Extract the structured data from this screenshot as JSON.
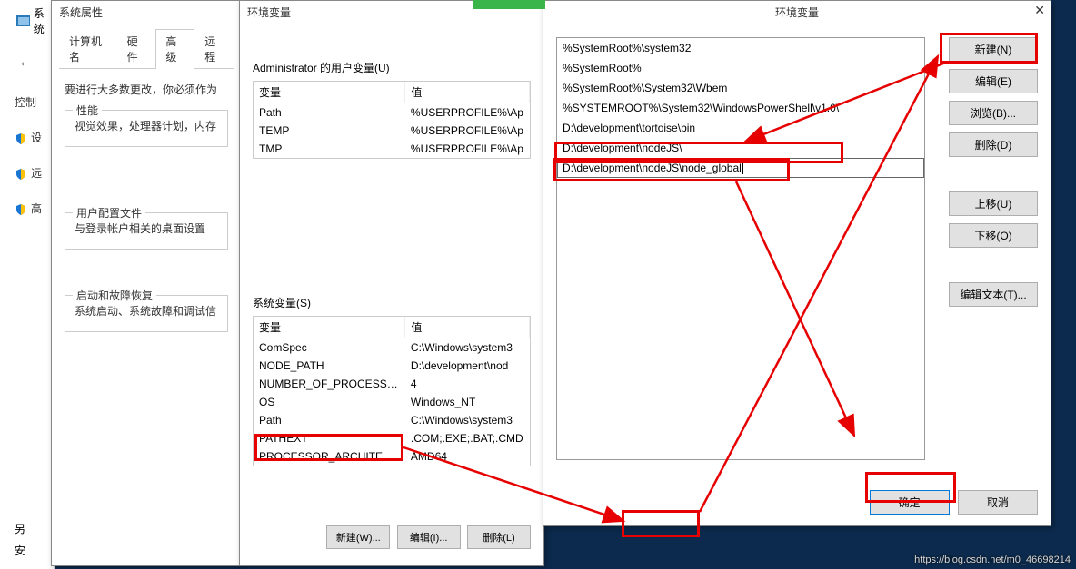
{
  "browser": {
    "title_truncated": "系统",
    "side": {
      "control": "控制",
      "settings": "设",
      "remote": "远",
      "advanced": "高",
      "other": "另",
      "security": "安"
    }
  },
  "sysDialog": {
    "title": "系统属性",
    "tabs": {
      "computer_name": "计算机名",
      "hardware": "硬件",
      "advanced": "高级",
      "remote": "远程"
    },
    "note": "要进行大多数更改，你必须作为",
    "perf": {
      "label": "性能",
      "desc": "视觉效果，处理器计划，内存"
    },
    "userProfile": {
      "label": "用户配置文件",
      "desc": "与登录帐户相关的桌面设置"
    },
    "startup": {
      "label": "启动和故障恢复",
      "desc": "系统启动、系统故障和调试信"
    }
  },
  "envDialog": {
    "title": "环境变量",
    "userSection": "Administrator 的用户变量(U)",
    "sysSection": "系统变量(S)",
    "headers": {
      "var": "变量",
      "val": "值"
    },
    "userVars": [
      {
        "name": "Path",
        "val": "%USERPROFILE%\\Ap"
      },
      {
        "name": "TEMP",
        "val": "%USERPROFILE%\\Ap"
      },
      {
        "name": "TMP",
        "val": "%USERPROFILE%\\Ap"
      }
    ],
    "sysVars": [
      {
        "name": "ComSpec",
        "val": "C:\\Windows\\system3"
      },
      {
        "name": "NODE_PATH",
        "val": "D:\\development\\nod"
      },
      {
        "name": "NUMBER_OF_PROCESSORS",
        "val": "4"
      },
      {
        "name": "OS",
        "val": "Windows_NT"
      },
      {
        "name": "Path",
        "val": "C:\\Windows\\system3"
      },
      {
        "name": "PATHEXT",
        "val": ".COM;.EXE;.BAT;.CMD"
      },
      {
        "name": "PROCESSOR_ARCHITECT...",
        "val": "AMD64"
      }
    ],
    "btns": {
      "new": "新建(W)...",
      "edit": "编辑(I)...",
      "del": "删除(L)"
    }
  },
  "pathDialog": {
    "title": "环境变量",
    "items": [
      "%SystemRoot%\\system32",
      "%SystemRoot%",
      "%SystemRoot%\\System32\\Wbem",
      "%SYSTEMROOT%\\System32\\WindowsPowerShell\\v1.0\\",
      "D:\\development\\tortoise\\bin",
      "D:\\development\\nodeJS\\"
    ],
    "editingItem": "D:\\development\\nodeJS\\node_global",
    "sideBtns": {
      "new": "新建(N)",
      "edit": "编辑(E)",
      "browse": "浏览(B)...",
      "del": "删除(D)",
      "up": "上移(U)",
      "down": "下移(O)",
      "editText": "编辑文本(T)..."
    },
    "bottomBtns": {
      "ok": "确定",
      "cancel": "取消"
    }
  },
  "watermark": "https://blog.csdn.net/m0_46698214"
}
